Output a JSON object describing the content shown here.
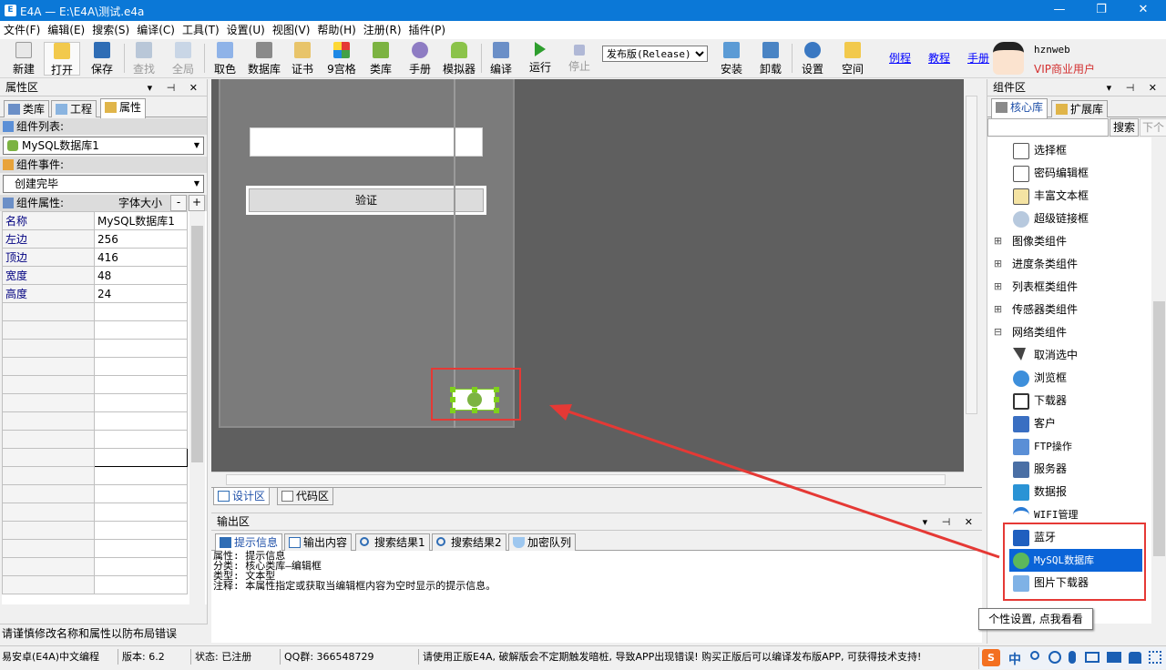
{
  "window": {
    "title": "E4A — E:\\E4A\\测试.e4a",
    "icon_text": "E",
    "minimize_glyph": "—",
    "maximize_glyph": "❐",
    "close_glyph": "✕"
  },
  "menu": [
    "文件(F)",
    "编辑(E)",
    "搜索(S)",
    "编译(C)",
    "工具(T)",
    "设置(U)",
    "视图(V)",
    "帮助(H)",
    "注册(R)",
    "插件(P)"
  ],
  "toolbar": {
    "buttons": {
      "new": "新建",
      "open": "打开",
      "save": "保存",
      "find": "查找",
      "fullscreen": "全局",
      "color": "取色",
      "database": "数据库",
      "cert": "证书",
      "grid9": "9宫格",
      "lib": "类库",
      "manual": "手册",
      "emulator": "模拟器",
      "compile": "编译",
      "run": "运行",
      "stop": "停止",
      "install": "安装",
      "uninstall": "卸载",
      "settings": "设置",
      "space": "空间"
    },
    "build_mode": "发布版(Release)",
    "links": {
      "examples": "例程",
      "tutorial": "教程",
      "manual": "手册"
    },
    "user": {
      "name": "hznweb",
      "level": "VIP商业用户"
    }
  },
  "left_panel": {
    "title": "属性区",
    "head_controls": "▾ ⊣ ✕",
    "tabs": [
      "类库",
      "工程",
      "属性"
    ],
    "component_list_label": "组件列表:",
    "component_selected": "MySQL数据库1",
    "event_label": "组件事件:",
    "event_selected": "创建完毕",
    "props_label": "组件属性:",
    "font_size_label": "字体大小",
    "font_minus": "-",
    "font_plus": "+",
    "properties": [
      {
        "name": "名称",
        "value": "MySQL数据库1"
      },
      {
        "name": "左边",
        "value": "256"
      },
      {
        "name": "顶边",
        "value": "416"
      },
      {
        "name": "宽度",
        "value": "48"
      },
      {
        "name": "高度",
        "value": "24"
      }
    ],
    "hint": "请谨慎修改名称和属性以防布局错误"
  },
  "designer": {
    "button_text": "验证",
    "tabs": [
      "设计区",
      "代码区"
    ]
  },
  "output_panel": {
    "title": "输出区",
    "head_controls": "▾ ⊣ ✕",
    "tabs": [
      "提示信息",
      "输出内容",
      "搜索结果1",
      "搜索结果2",
      "加密队列"
    ],
    "lines": [
      "属性: 提示信息",
      "分类: 核心类库—编辑框",
      "类型: 文本型",
      "注释: 本属性指定或获取当编辑框内容为空时显示的提示信息。"
    ]
  },
  "right_panel": {
    "title": "组件区",
    "head_controls": "▾ ⊣ ✕",
    "tabs": [
      "核心库",
      "扩展库"
    ],
    "search_button": "搜索",
    "next_button": "下个",
    "tree": [
      {
        "label": "选择框",
        "type": "item"
      },
      {
        "label": "密码编辑框",
        "type": "item"
      },
      {
        "label": "丰富文本框",
        "type": "item"
      },
      {
        "label": "超级链接框",
        "type": "item"
      },
      {
        "label": "图像类组件",
        "type": "group",
        "sign": "⊞"
      },
      {
        "label": "进度条类组件",
        "type": "group",
        "sign": "⊞"
      },
      {
        "label": "列表框类组件",
        "type": "group",
        "sign": "⊞"
      },
      {
        "label": "传感器类组件",
        "type": "group",
        "sign": "⊞"
      },
      {
        "label": "网络类组件",
        "type": "group",
        "sign": "⊟"
      },
      {
        "label": "取消选中",
        "type": "item"
      },
      {
        "label": "浏览框",
        "type": "item"
      },
      {
        "label": "下载器",
        "type": "item"
      },
      {
        "label": "客户",
        "type": "item"
      },
      {
        "label": "FTP操作",
        "type": "item"
      },
      {
        "label": "服务器",
        "type": "item"
      },
      {
        "label": "数据报",
        "type": "item"
      },
      {
        "label": "WIFI管理",
        "type": "item"
      },
      {
        "label": "蓝牙",
        "type": "item"
      },
      {
        "label": "MySQL数据库",
        "type": "item",
        "selected": true
      },
      {
        "label": "图片下载器",
        "type": "item"
      }
    ],
    "tooltip": "个性设置, 点我看看"
  },
  "statusbar": {
    "product": "易安卓(E4A)中文编程",
    "version": "版本: 6.2",
    "state": "状态: 已注册",
    "qq": "QQ群: 366548729",
    "notice": "请使用正版E4A, 破解版会不定期触发暗桩, 导致APP出现错误! 购买正版后可以编译发布版APP, 可获得技术支持!"
  },
  "ime": {
    "label": "中"
  },
  "colors": {
    "titlebar": "#0b78d7",
    "canvas": "#5f5f5f",
    "form": "#7b7b7b",
    "selection": "#0a64d8",
    "annotation": "#e53935",
    "handle": "#7fd11c"
  }
}
